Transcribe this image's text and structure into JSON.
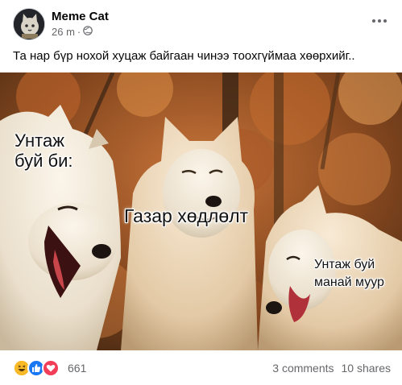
{
  "post": {
    "page_name": "Meme Cat",
    "timestamp": "26 m",
    "audience_icon": "globe-icon",
    "text": "Та нар бүр нохой хуцаж байгаан чинээ тоохгүймаа хөөрхийг..",
    "image": {
      "caption_left": "Унтаж\nбуй би:",
      "caption_middle": "Газар хөдлөлт",
      "caption_right": "Унтаж буй\nманай муур"
    },
    "reactions": {
      "icons": [
        "haha-icon",
        "like-icon",
        "love-icon"
      ],
      "count": "661"
    },
    "comments": "3 comments",
    "shares": "10 shares"
  },
  "colors": {
    "like": "#1877f2",
    "love": "#f33e58",
    "haha": "#f7b928",
    "secondary_text": "#65676b"
  }
}
